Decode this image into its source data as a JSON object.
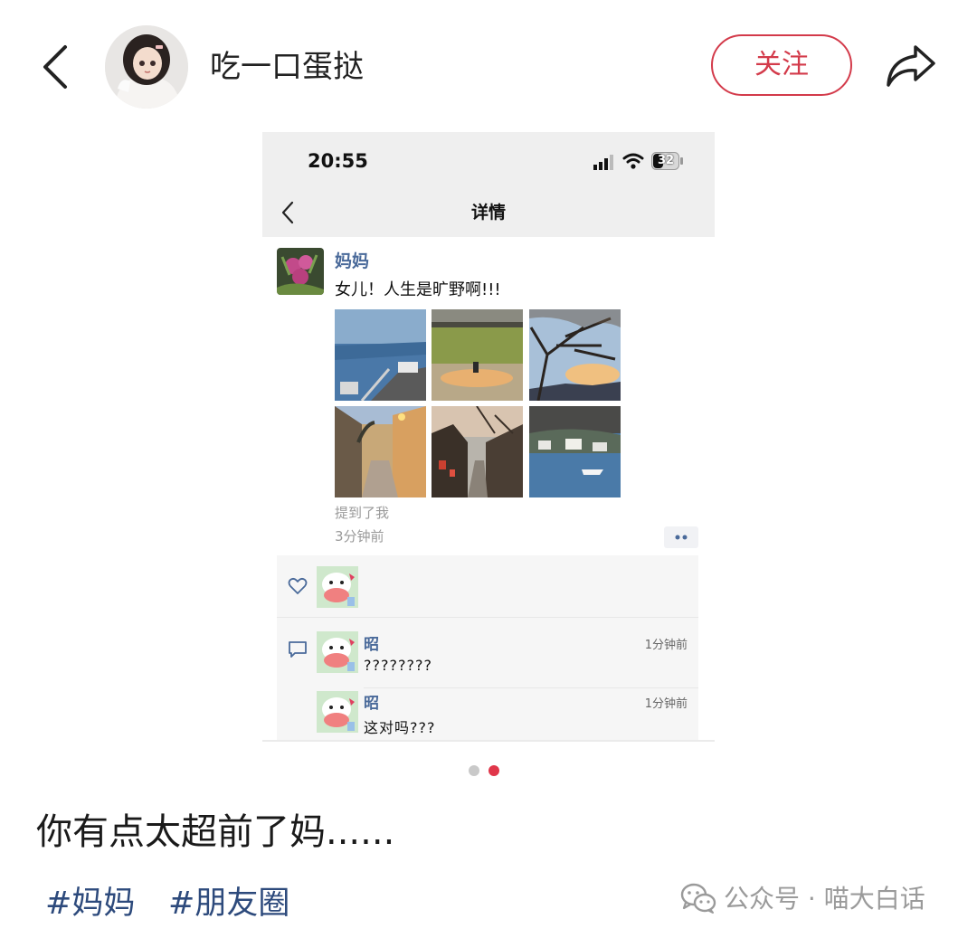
{
  "header": {
    "author_name": "吃一口蛋挞",
    "follow_label": "关注"
  },
  "screenshot": {
    "status_time": "20:55",
    "battery_level": "32",
    "page_title": "详情",
    "post": {
      "poster_name": "妈妈",
      "text": "女儿！人生是旷野啊!!!",
      "photos": [
        "lake-coast",
        "grass-field-pond",
        "tree-sunset",
        "old-town-alley",
        "old-street-roofs",
        "lake-boat-village"
      ],
      "mention": "提到了我",
      "time": "3分钟前"
    },
    "comments": [
      {
        "name": "昭",
        "text": "????????",
        "time": "1分钟前"
      },
      {
        "name": "昭",
        "text": "这对吗???",
        "time": "1分钟前"
      }
    ]
  },
  "pagination": {
    "total": 2,
    "current": 2
  },
  "caption": "你有点太超前了妈......",
  "tags": [
    "#妈妈",
    "#朋友圈"
  ],
  "watermark": "公众号 · 喵大白话",
  "colors": {
    "accent": "#d33a4a",
    "link": "#4a6a9a",
    "tag": "#2d4a7c",
    "active_dot": "#e0364a"
  }
}
